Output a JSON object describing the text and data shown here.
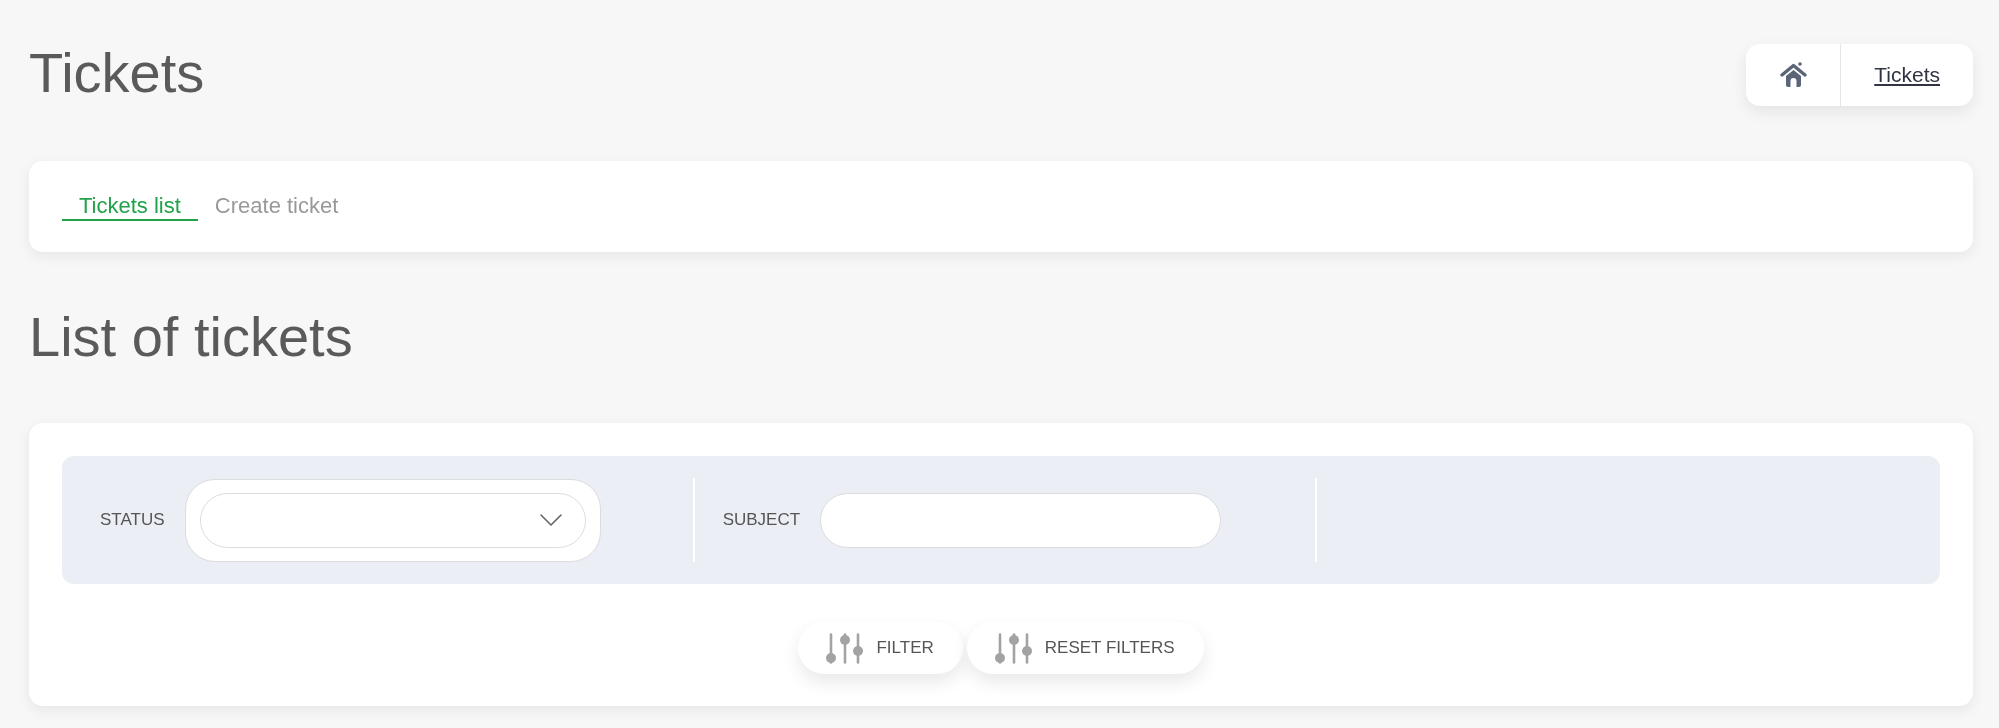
{
  "page": {
    "title": "Tickets"
  },
  "breadcrumb": {
    "link": "Tickets"
  },
  "tabs": [
    {
      "label": "Tickets list",
      "selected": true
    },
    {
      "label": "Create ticket",
      "selected": false
    }
  ],
  "section": {
    "title": "List of tickets"
  },
  "filters": [
    {
      "kind": "select",
      "label": "STATUS"
    },
    {
      "kind": "text",
      "label": "SUBJECT"
    }
  ],
  "buttons": [
    {
      "label": "FILTER"
    },
    {
      "label": "RESET FILTERS"
    }
  ]
}
